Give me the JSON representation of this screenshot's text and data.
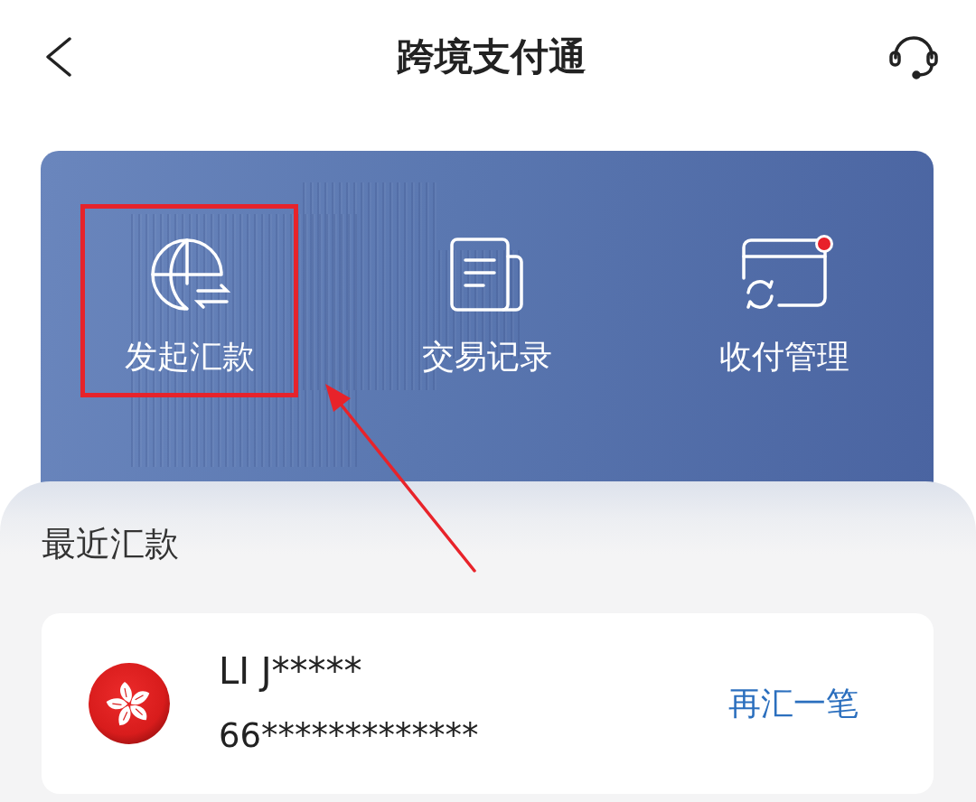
{
  "header": {
    "title": "跨境支付通"
  },
  "actions": [
    {
      "label": "发起汇款",
      "highlighted": true,
      "badge": false
    },
    {
      "label": "交易记录",
      "highlighted": false,
      "badge": false
    },
    {
      "label": "收付管理",
      "highlighted": false,
      "badge": true
    }
  ],
  "pointer_arrow": true,
  "recent": {
    "title": "最近汇款",
    "items": [
      {
        "name": "LI J*****",
        "account": "66*************",
        "action": "再汇一笔"
      }
    ]
  }
}
